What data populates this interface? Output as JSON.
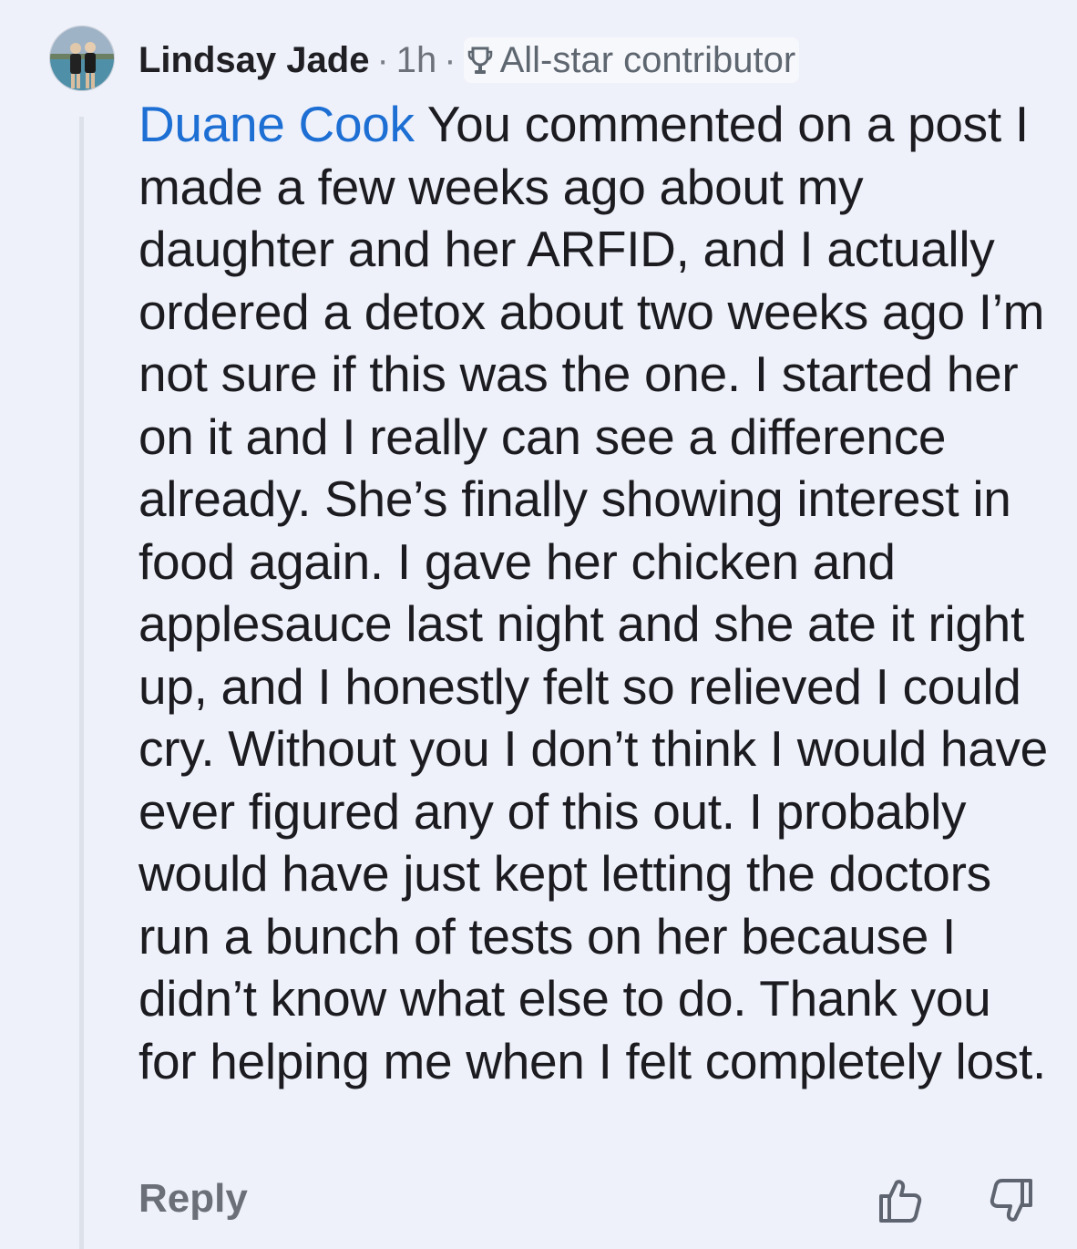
{
  "comment": {
    "author": "Lindsay Jade",
    "separator": "·",
    "time": "1h",
    "badge": {
      "icon": "trophy-icon",
      "label": "All-star contributor"
    },
    "mention": "Duane Cook",
    "text": " You commented on a post I made a few weeks ago about my daughter and her ARFID, and I actually ordered a detox about two weeks ago I’m not sure if this was the one. I started her on it and I really can see a difference already. She’s finally showing interest in food again. I gave her chicken and applesauce last night and she ate it right up, and I honestly felt so relieved I could cry. Without you I don’t think I would have ever figured any of this out. I probably would have just kept letting the doctors run a bunch of tests on her because I didn’t know what else to do. Thank you for helping me when I felt completely lost.",
    "mention_color": "#1d6fd4"
  },
  "actions": {
    "reply_label": "Reply",
    "upvote_icon": "thumbs-up-icon",
    "downvote_icon": "thumbs-down-icon"
  }
}
